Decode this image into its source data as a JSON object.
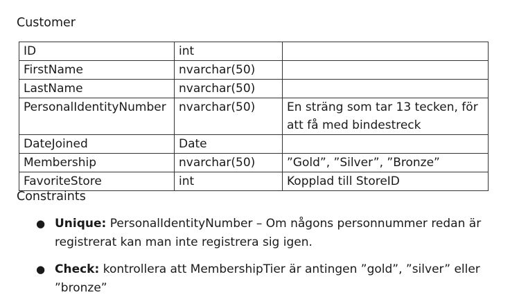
{
  "title": "Customer",
  "table": {
    "rows": [
      {
        "name": "ID",
        "type": "int",
        "note": ""
      },
      {
        "name": "FirstName",
        "type": "nvarchar(50)",
        "note": ""
      },
      {
        "name": "LastName",
        "type": "nvarchar(50)",
        "note": ""
      },
      {
        "name": "PersonalIdentityNumber",
        "type": "nvarchar(50)",
        "note": "En sträng som tar 13 tecken, för att få med bindestreck"
      },
      {
        "name": "DateJoined",
        "type": "Date",
        "note": ""
      },
      {
        "name": "Membership",
        "type": "nvarchar(50)",
        "note": "”Gold”, ”Silver”, ”Bronze”"
      },
      {
        "name": "FavoriteStore",
        "type": "int",
        "note": "Kopplad till StoreID"
      }
    ]
  },
  "constraints": {
    "title": "Constraints",
    "items": [
      {
        "label": "Unique:",
        "text": " PersonalIdentityNumber – Om någons personnummer redan är registrerat kan man inte registrera sig igen."
      },
      {
        "label": "Check:",
        "text": " kontrollera att MembershipTier är antingen ”gold”, ”silver” eller ”bronze”"
      }
    ]
  }
}
